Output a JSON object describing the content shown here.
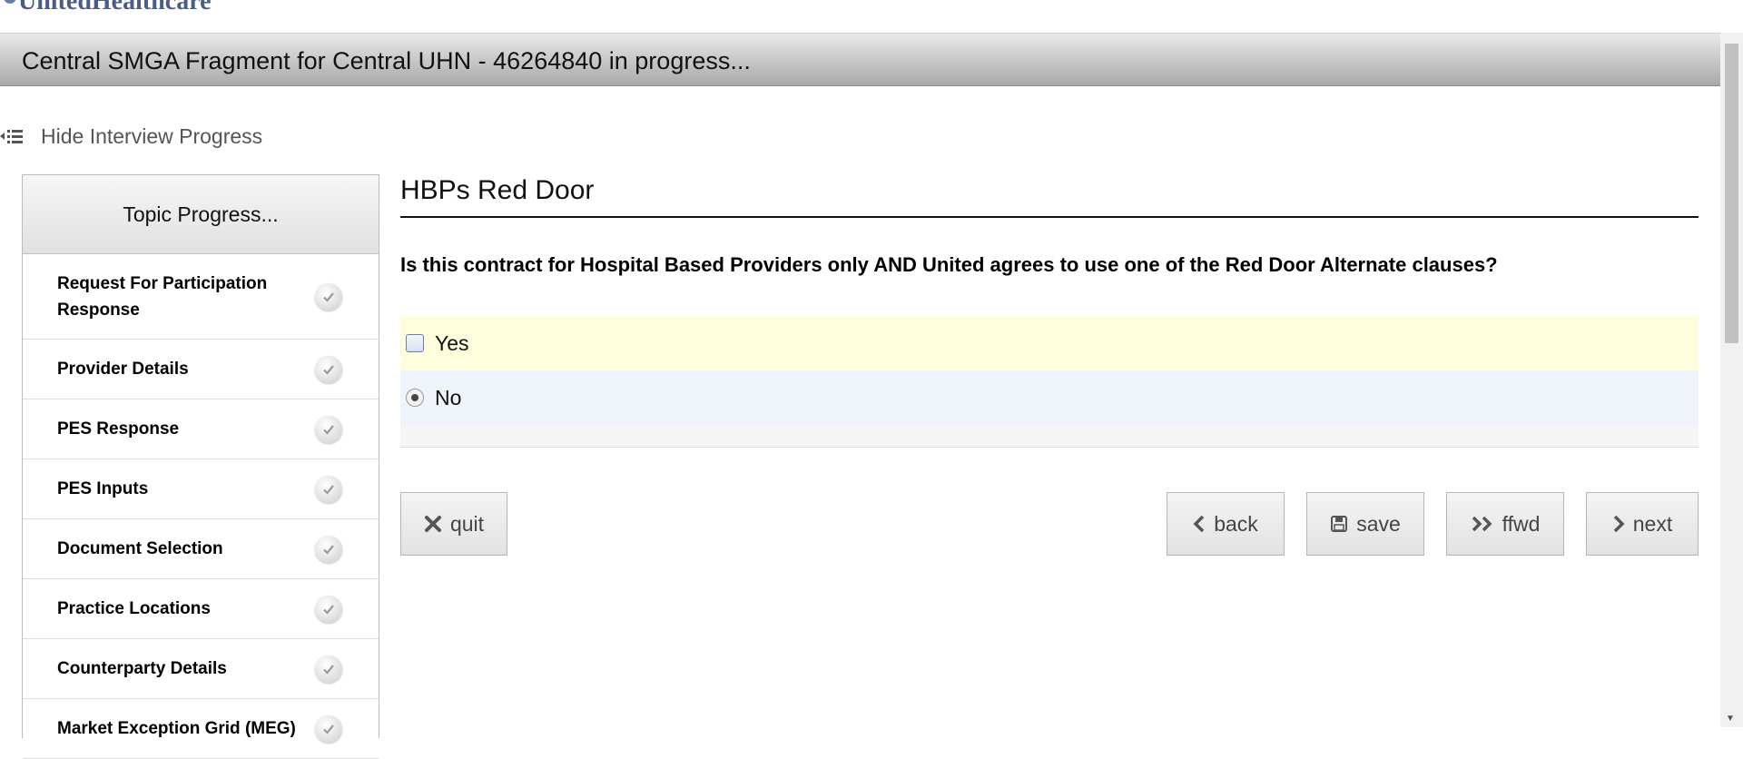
{
  "page": {
    "logo_text": "UnitedHealthcare",
    "window_title": "Central SMGA Fragment for Central UHN - 46264840 in progress..."
  },
  "toggle": {
    "label": "Hide Interview Progress",
    "icon": "collapse-list-icon"
  },
  "sidebar": {
    "header": "Topic Progress...",
    "items": [
      {
        "label": "Request For Participation Response",
        "status": "complete",
        "icon": "check-circle-icon"
      },
      {
        "label": "Provider Details",
        "status": "complete",
        "icon": "check-circle-icon"
      },
      {
        "label": "PES Response",
        "status": "complete",
        "icon": "check-circle-icon"
      },
      {
        "label": "PES Inputs",
        "status": "complete",
        "icon": "check-circle-icon"
      },
      {
        "label": "Document Selection",
        "status": "complete",
        "icon": "check-circle-icon"
      },
      {
        "label": "Practice Locations",
        "status": "complete",
        "icon": "check-circle-icon"
      },
      {
        "label": "Counterparty Details",
        "status": "complete",
        "icon": "check-circle-icon"
      },
      {
        "label": "Market Exception Grid (MEG)",
        "status": "complete",
        "icon": "check-circle-icon"
      }
    ]
  },
  "main": {
    "section_title": "HBPs Red Door",
    "question": "Is this contract for Hospital Based Providers only AND United agrees to use one of the Red Door Alternate clauses?",
    "options": [
      {
        "label": "Yes",
        "selected": false
      },
      {
        "label": "No",
        "selected": true
      }
    ]
  },
  "buttons": {
    "quit": "quit",
    "back": "back",
    "save": "save",
    "ffwd": "ffwd",
    "next": "next"
  },
  "colors": {
    "highlight_yes": "#fefedd",
    "highlight_no": "#eff3fa",
    "title_bar": "#a9a9a9"
  }
}
